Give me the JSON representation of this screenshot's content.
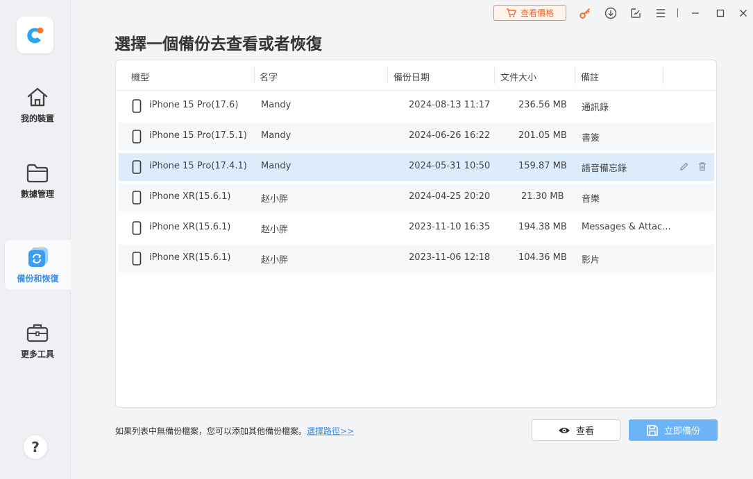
{
  "sidebar": {
    "items": [
      {
        "label": "我的裝置",
        "icon": "home-icon"
      },
      {
        "label": "數據管理",
        "icon": "folder-icon"
      },
      {
        "label": "備份和恢復",
        "icon": "backup-restore-icon"
      },
      {
        "label": "更多工具",
        "icon": "toolbox-icon"
      }
    ],
    "help_label": "?"
  },
  "titlebar": {
    "price_label": "查看價格"
  },
  "main": {
    "title": "選擇一個備份去查看或者恢復",
    "columns": [
      "機型",
      "名字",
      "備份日期",
      "文件大小",
      "備註"
    ],
    "rows": [
      {
        "model": "iPhone 15 Pro(17.6)",
        "name": "Mandy",
        "date": "2024-08-13 11:17",
        "size": "236.56 MB",
        "note": "通訊錄"
      },
      {
        "model": "iPhone 15 Pro(17.5.1)",
        "name": "Mandy",
        "date": "2024-06-26 16:22",
        "size": "201.05 MB",
        "note": "書簽"
      },
      {
        "model": "iPhone 15 Pro(17.4.1)",
        "name": "Mandy",
        "date": "2024-05-31 10:50",
        "size": "159.87 MB",
        "note": "語音備忘錄"
      },
      {
        "model": "iPhone XR(15.6.1)",
        "name": "赵小胖",
        "date": "2024-04-25 20:20",
        "size": "21.30 MB",
        "note": "音樂"
      },
      {
        "model": "iPhone XR(15.6.1)",
        "name": "赵小胖",
        "date": "2023-11-10 16:35",
        "size": "194.38 MB",
        "note": "Messages & Attac..."
      },
      {
        "model": "iPhone XR(15.6.1)",
        "name": "赵小胖",
        "date": "2023-11-06 12:18",
        "size": "104.36 MB",
        "note": "影片"
      }
    ]
  },
  "footer": {
    "note": "如果列表中無備份檔案，您可以添加其他備份檔案。",
    "link": "選擇路徑>>",
    "view_label": "查看",
    "backup_label": "立即備份"
  },
  "colors": {
    "accent": "#3a8ee6",
    "orange": "#ee6b2a",
    "selected_row": "#dcecfb",
    "backup_button": "#6cb4f5"
  }
}
